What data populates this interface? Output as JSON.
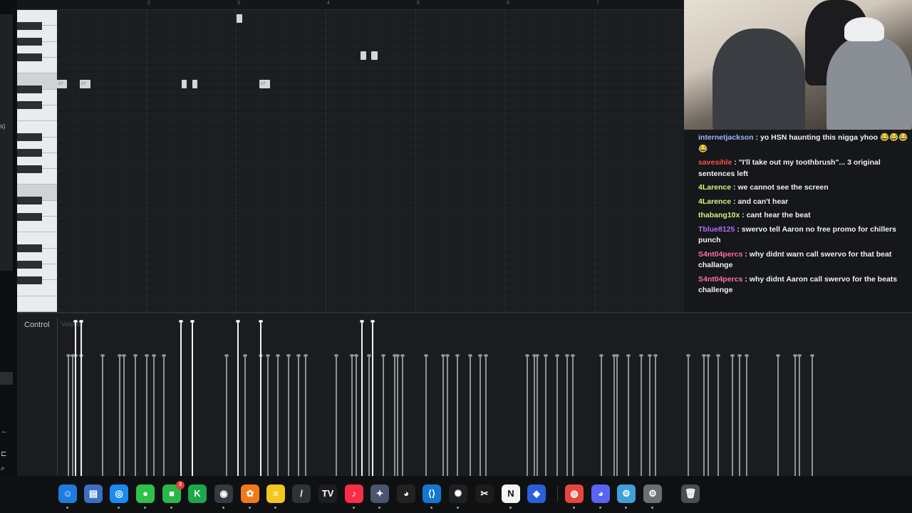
{
  "piano_roll": {
    "bar_numbers": [
      "2",
      "3",
      "4",
      "5",
      "6",
      "7"
    ],
    "note_labels": {
      "c7": "C7"
    }
  },
  "control_lane": {
    "label": "Control",
    "param": "Velocity"
  },
  "left_gutter": {
    "text": "s)"
  },
  "chat": {
    "messages": [
      {
        "user": "internetjackson",
        "color": "#9fb4ff",
        "text": "yo HSN haunting this nigga yhoo 😂😂😂😂"
      },
      {
        "user": "savesihle",
        "color": "#ff4d4d",
        "text": "\"I'll take out my toothbrush\"... 3 original sentences left"
      },
      {
        "user": "4Larence",
        "color": "#d7f27a",
        "text": "we cannot see the screen"
      },
      {
        "user": "4Larence",
        "color": "#d7f27a",
        "text": "and can't hear"
      },
      {
        "user": "thabang10x",
        "color": "#d7f27a",
        "text": "cant hear the beat"
      },
      {
        "user": "Tblue8125",
        "color": "#b06cff",
        "text": "swervo tell Aaron no free promo for chillers punch"
      },
      {
        "user": "S4nt04percs",
        "color": "#ff6fae",
        "text": "why didnt warn call swervo for that beat challange"
      },
      {
        "user": "S4nt04percs",
        "color": "#ff6fae",
        "text": "why didnt Aaron call swervo for the beats challenge"
      }
    ]
  },
  "dock": {
    "facetime_badge": "3",
    "apps": [
      {
        "name": "finder-icon",
        "glyph": "☺",
        "bg": "#1e7be0"
      },
      {
        "name": "files-icon",
        "glyph": "▤",
        "bg": "#3a6fc4"
      },
      {
        "name": "safari-icon",
        "glyph": "◎",
        "bg": "#1a8cf0"
      },
      {
        "name": "messages-icon",
        "glyph": "●",
        "bg": "#2fc24a"
      },
      {
        "name": "facetime-icon",
        "glyph": "■",
        "bg": "#28b84a"
      },
      {
        "name": "keynote-k-icon",
        "glyph": "K",
        "bg": "#1aa84d"
      },
      {
        "name": "obs-icon",
        "glyph": "◉",
        "bg": "#333a44"
      },
      {
        "name": "fl-studio-icon",
        "glyph": "✿",
        "bg": "#f07a1a"
      },
      {
        "name": "notes-icon",
        "glyph": "≡",
        "bg": "#f3c622"
      },
      {
        "name": "pen-icon",
        "glyph": "/",
        "bg": "#2e3135"
      },
      {
        "name": "tradingview-icon",
        "glyph": "TV",
        "bg": "#1b1d20"
      },
      {
        "name": "music-icon",
        "glyph": "♪",
        "bg": "#fa2d48"
      },
      {
        "name": "davinci-icon",
        "glyph": "✦",
        "bg": "#4a5570"
      },
      {
        "name": "github-icon",
        "glyph": "◕",
        "bg": "#222"
      },
      {
        "name": "vscode-icon",
        "glyph": "⟨⟩",
        "bg": "#1578d0"
      },
      {
        "name": "chatgpt-icon",
        "glyph": "✺",
        "bg": "#1e1f22"
      },
      {
        "name": "capcut-icon",
        "glyph": "✂",
        "bg": "#1b1b1b"
      },
      {
        "name": "notion-icon",
        "glyph": "N",
        "bg": "#f4f4f4"
      },
      {
        "name": "blue-app-icon",
        "glyph": "◆",
        "bg": "#2b5fd9"
      },
      {
        "name": "chrome-icon",
        "glyph": "◍",
        "bg": "#e8453c"
      },
      {
        "name": "discord-icon",
        "glyph": "◕",
        "bg": "#5865f2"
      },
      {
        "name": "instruments-icon",
        "glyph": "⚙",
        "bg": "#3ea0d8"
      },
      {
        "name": "system-settings-icon",
        "glyph": "⚙",
        "bg": "#6b6f74"
      },
      {
        "name": "trash-icon",
        "glyph": "🗑",
        "bg": "#4a4d51"
      }
    ]
  }
}
